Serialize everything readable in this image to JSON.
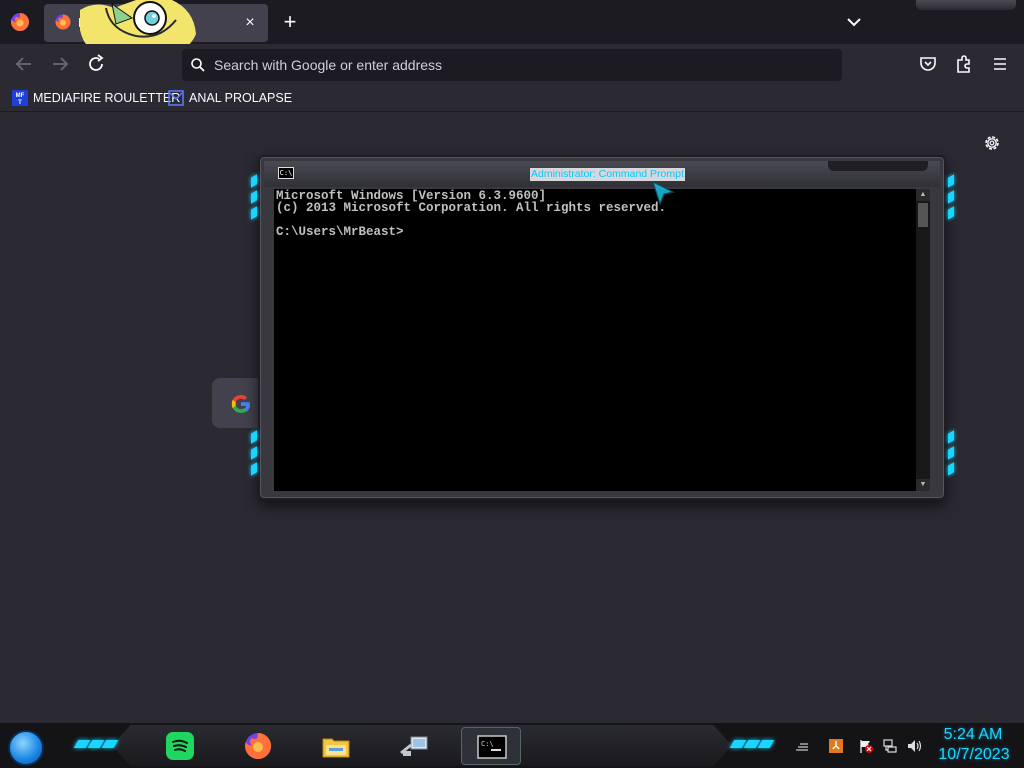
{
  "browser": {
    "tab": {
      "title": "N",
      "close_glyph": "×"
    },
    "new_tab_glyph": "+",
    "search": {
      "placeholder": "Search with Google or enter address"
    },
    "bookmarks": [
      {
        "label": "MEDIAFIRE ROULETTER",
        "icon": "mediafire-icon"
      },
      {
        "label": "ANAL PROLAPSE",
        "icon": "bookmark-icon"
      }
    ]
  },
  "cmd": {
    "title": "Administrator: Command Prompt",
    "sys_icon_text": "C:\\",
    "lines": [
      "Microsoft Windows [Version 6.3.9600]",
      "(c) 2013 Microsoft Corporation. All rights reserved.",
      "",
      "C:\\Users\\MrBeast>"
    ]
  },
  "taskbar": {
    "items": [
      "spotify-icon",
      "firefox-icon",
      "file-explorer-icon",
      "network-share-icon",
      "command-prompt-icon"
    ],
    "active": "command-prompt-icon"
  },
  "clock": {
    "time": "5:24 AM",
    "date": "10/7/2023"
  },
  "colors": {
    "accent_cyan": "#19d5ff",
    "browser_bg": "#2b2a33",
    "tab_bar": "#1c1b22"
  }
}
